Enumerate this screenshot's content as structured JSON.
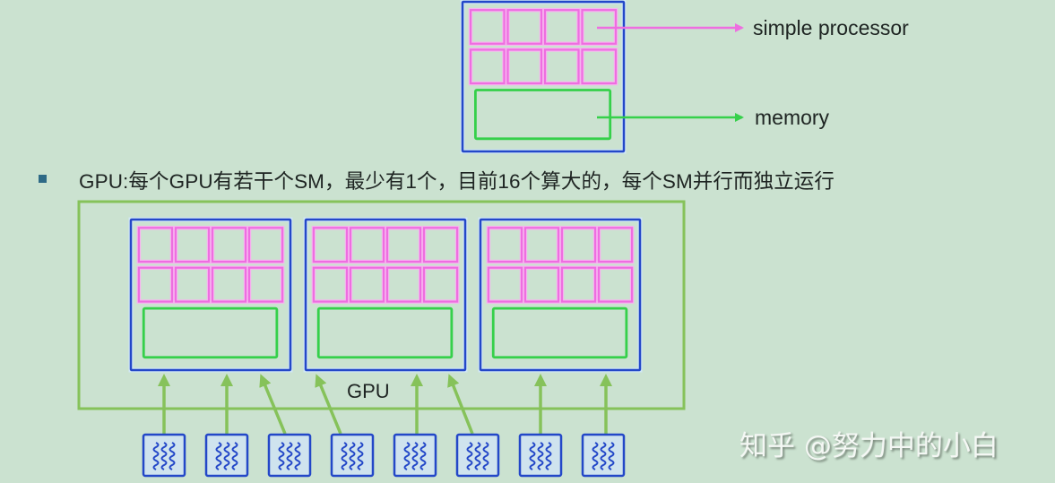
{
  "legend": {
    "processor_label": "simple processor",
    "memory_label": "memory"
  },
  "bullet": {
    "text": "GPU:每个GPU有若干个SM，最少有1个，目前16个算大的，每个SM并行而独立运行"
  },
  "gpu": {
    "label": "GPU",
    "sm_count": 3,
    "processors_per_sm": 8,
    "processor_grid": {
      "rows": 2,
      "cols": 4
    }
  },
  "thread_blocks": {
    "count": 8,
    "icon": "wavy-threads-icon",
    "arrow_targets": [
      "sm-1",
      "sm-1",
      "sm-1",
      "sm-2",
      "sm-2",
      "sm-2",
      "sm-3",
      "sm-3"
    ]
  },
  "colors": {
    "background": "#cbe2d0",
    "sm_border": "#2347c8",
    "processor": "#ee6ee0",
    "memory": "#35d04a",
    "gpu_border": "#86c25a",
    "arrow_block": "#86c25a",
    "thread_icon": "#2347c8"
  },
  "watermark": {
    "text": "知乎 @努力中的小白"
  }
}
